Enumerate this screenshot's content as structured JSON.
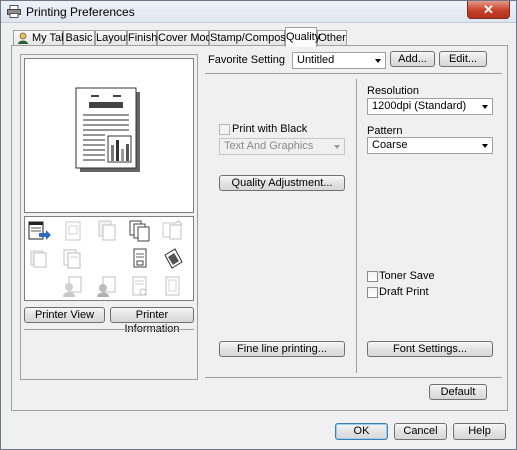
{
  "window": {
    "title": "Printing Preferences",
    "close_glyph": "✕"
  },
  "tabs": [
    {
      "label": "My Tab"
    },
    {
      "label": "Basic"
    },
    {
      "label": "Layout"
    },
    {
      "label": "Finish"
    },
    {
      "label": "Cover Mode"
    },
    {
      "label": "Stamp/Composition"
    },
    {
      "label": "Quality"
    },
    {
      "label": "Other"
    }
  ],
  "active_tab": "Quality",
  "preview": {
    "printer_view_label": "Printer View",
    "printer_info_label": "Printer Information"
  },
  "favorite": {
    "label": "Favorite Setting",
    "value": "Untitled",
    "add_label": "Add...",
    "edit_label": "Edit..."
  },
  "quality": {
    "print_with_black_label": "Print with Black",
    "print_with_black_checked": false,
    "text_graphics_value": "Text And Graphics",
    "quality_adjustment_label": "Quality Adjustment...",
    "fine_line_label": "Fine line printing...",
    "resolution_label": "Resolution",
    "resolution_value": "1200dpi (Standard)",
    "pattern_label": "Pattern",
    "pattern_value": "Coarse",
    "toner_save_label": "Toner Save",
    "toner_save_checked": false,
    "draft_print_label": "Draft Print",
    "draft_print_checked": false,
    "font_settings_label": "Font Settings...",
    "default_label": "Default"
  },
  "footer": {
    "ok_label": "OK",
    "cancel_label": "Cancel",
    "help_label": "Help"
  },
  "icons": {
    "title": "printer-icon",
    "mytab": "user-icon",
    "grid": [
      "printer-layout-icon",
      "page-dim-icon",
      "copies-dim-icon",
      "collate-icon",
      "staple-dim-icon",
      "stack-dim-icon",
      "booklet-dim-icon",
      "page-select-icon",
      "stamp-icon",
      "watermark-dim-icon",
      "overlay-dim-icon",
      "header-dim-icon",
      "frame-dim-icon"
    ]
  },
  "colors": {
    "accent_blue": "#2f6cc0",
    "close_red": "#c7412a",
    "button_border_default": "#3c7fb1"
  }
}
